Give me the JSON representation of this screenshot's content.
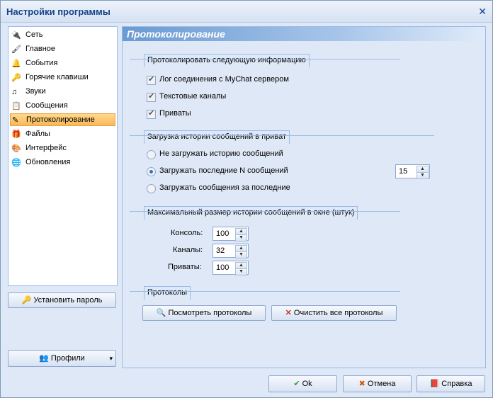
{
  "window": {
    "title": "Настройки программы"
  },
  "sidebar": {
    "items": [
      {
        "label": "Сеть"
      },
      {
        "label": "Главное"
      },
      {
        "label": "События"
      },
      {
        "label": "Горячие клавиши"
      },
      {
        "label": "Звуки"
      },
      {
        "label": "Сообщения"
      },
      {
        "label": "Протоколирование"
      },
      {
        "label": "Файлы"
      },
      {
        "label": "Интерфейс"
      },
      {
        "label": "Обновления"
      }
    ],
    "set_password_label": "Установить пароль",
    "profiles_label": "Профили"
  },
  "main": {
    "header": "Протоколирование",
    "log_info": {
      "title": "Протоколировать следующую информацию",
      "items": [
        {
          "label": "Лог соединения с MyChat сервером",
          "checked": true
        },
        {
          "label": "Текстовые каналы",
          "checked": true
        },
        {
          "label": "Приваты",
          "checked": true
        }
      ]
    },
    "history_load": {
      "title": "Загрузка истории сообщений в приват",
      "options": [
        {
          "label": "Не загружать историю сообщений",
          "selected": false
        },
        {
          "label": "Загружать последние N сообщений",
          "selected": true
        },
        {
          "label": "Загружать сообщения за последние",
          "selected": false
        }
      ],
      "n_value": "15"
    },
    "history_max": {
      "title": "Максимальный размер истории сообщений в окне (штук)",
      "fields": [
        {
          "label": "Консоль:",
          "value": "100"
        },
        {
          "label": "Каналы:",
          "value": "32"
        },
        {
          "label": "Приваты:",
          "value": "100"
        }
      ]
    },
    "protocols": {
      "title": "Протоколы",
      "view_label": "Посмотреть протоколы",
      "clear_label": "Очистить все протоколы"
    }
  },
  "footer": {
    "ok_label": "Ok",
    "cancel_label": "Отмена",
    "help_label": "Справка"
  }
}
